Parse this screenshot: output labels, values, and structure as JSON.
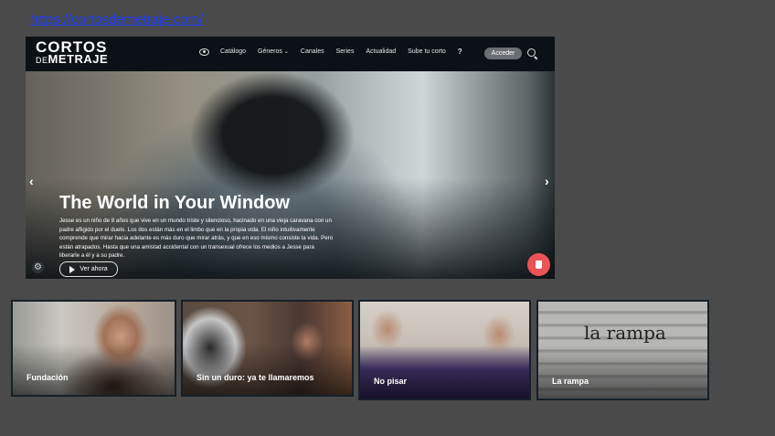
{
  "url": "https://cortosdemetraje.com/",
  "site": {
    "logo_line1": "CORTOS",
    "logo_de": "DE",
    "logo_line2": "METRAJE",
    "nav": {
      "catalog": "Catálogo",
      "genres": "Géneros",
      "channels": "Canales",
      "series": "Series",
      "news": "Actualidad",
      "upload": "Sube tu corto",
      "help": "?"
    },
    "login_label": "Acceder",
    "hero": {
      "title": "The World in Your Window",
      "description": "Jesse es un niño de 8 años que vive en un mundo triste y silencioso, hacinado en una vieja caravana con un padre afligido por el duelo. Los dos están más en el limbo que en la propia vida. El niño intuitivamente comprende que mirar hacia adelante es más duro que mirar atrás, y que en eso mismo consiste la vida. Pero están atrapados. Hasta que una amistad accidental con un transexual ofrece los medios a Jesse para liberarle a él y a su padre.",
      "watch_label": "Ver ahora",
      "prev_arrow": "‹",
      "next_arrow": "›"
    }
  },
  "cards": [
    {
      "label": "Fundación"
    },
    {
      "label": "Sin un duro: ya te llamaremos"
    },
    {
      "label": "No pisar"
    },
    {
      "label": "La rampa",
      "image_text": "la rampa"
    }
  ],
  "colors": {
    "page_bg": "#4a4a4a",
    "accent_red": "#ea5455",
    "link_blue": "#1a3cff"
  }
}
